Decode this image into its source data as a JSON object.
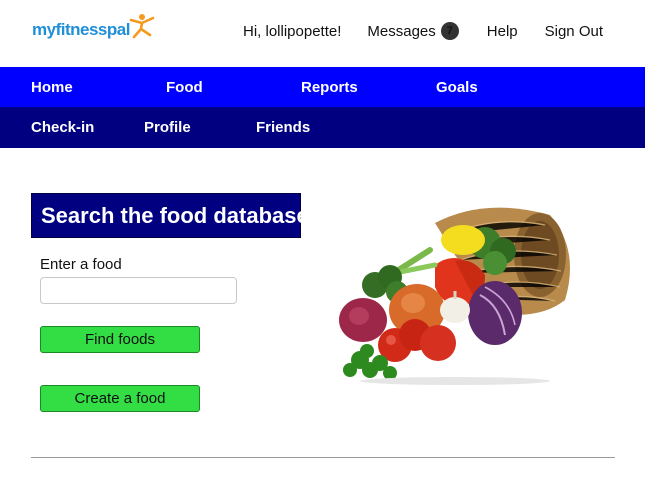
{
  "brand": {
    "part1": "my",
    "part2": "fitness",
    "part3": "pal"
  },
  "top_links": {
    "greeting": "Hi, lollipopette!",
    "messages_label": "Messages",
    "messages_count": "7",
    "help": "Help",
    "sign_out": "Sign Out"
  },
  "nav_primary": [
    {
      "label": "Home"
    },
    {
      "label": "Food"
    },
    {
      "label": "Reports"
    },
    {
      "label": "Goals"
    }
  ],
  "nav_secondary": [
    {
      "label": "Check-in"
    },
    {
      "label": "Profile"
    },
    {
      "label": "Friends"
    }
  ],
  "search": {
    "title": "Search the food database",
    "field_label": "Enter a food",
    "field_value": "",
    "field_placeholder": "",
    "find_button": "Find foods",
    "create_button": "Create a food"
  },
  "colors": {
    "nav_primary": "#0000ff",
    "nav_secondary": "#000080",
    "button": "#33dd44",
    "title_bg": "#000080",
    "brand": "#1f8fd8"
  },
  "icons": {
    "logo_figure": "person-jumping-icon",
    "messages_badge": "count-badge"
  }
}
